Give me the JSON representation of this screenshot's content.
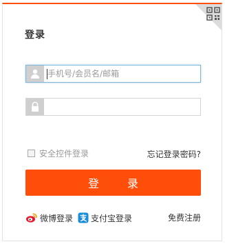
{
  "login": {
    "title": "登录",
    "account_field": {
      "value": "",
      "placeholder": "手机号/会员名/邮箱",
      "icon": "user-icon"
    },
    "password_field": {
      "value": "",
      "placeholder": "",
      "icon": "lock-icon"
    },
    "security_control_label": "安全控件登录",
    "forgot_password_label": "忘记登录密码?",
    "submit_label": "登 录",
    "weibo_label": "微博登录",
    "alipay_label": "支付宝登录",
    "register_label": "免费注册",
    "qr_corner_icon": "qr-code-icon"
  },
  "colors": {
    "accent": "#ff4d0a",
    "border": "#d3d3d3",
    "focus_border": "#7fb6d6",
    "icon_bg": "#cfcfcf",
    "muted_text": "#9a9a9a",
    "weibo": "#e6162d",
    "alipay": "#1a8dd8"
  }
}
